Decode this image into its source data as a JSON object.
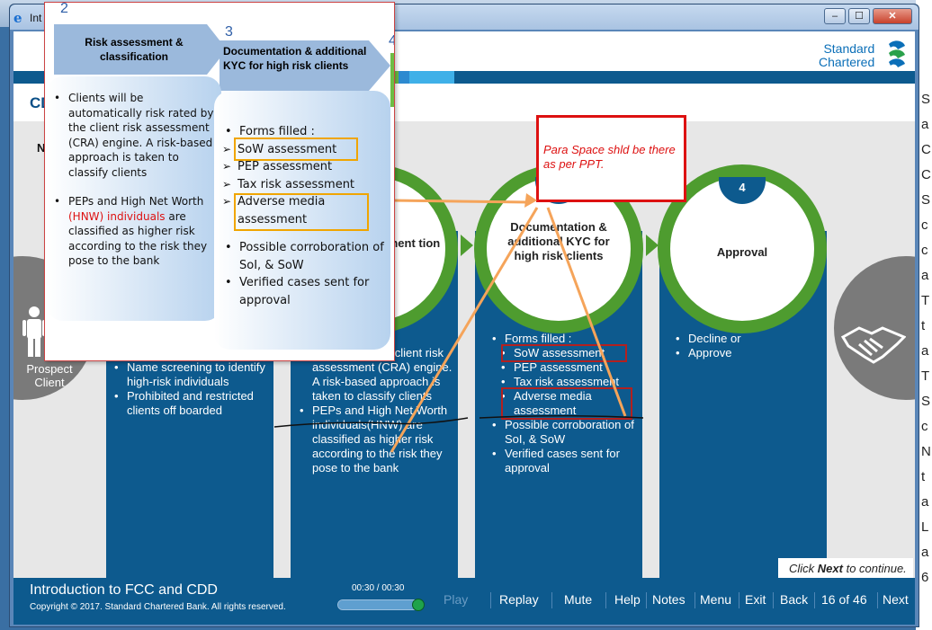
{
  "window": {
    "title": "Int",
    "minimize": "–",
    "maximize": "☐",
    "close": "✕"
  },
  "background_right_text": [
    "S",
    "a",
    "C",
    "C",
    "S",
    "c",
    "c",
    "a",
    "T",
    "t",
    "a",
    "T",
    "S",
    "c",
    "N",
    "t",
    "a",
    "L",
    "a",
    "6"
  ],
  "slide": {
    "logo_line1": "Standard",
    "logo_line2": "Chartered",
    "heading": "CD",
    "sub_heading": "N",
    "prospect_label": "Prospect Client",
    "columns": [
      {
        "items": [
          "Name screening to identify high-risk individuals",
          "Prohibited and restricted clients off boarded"
        ]
      },
      {
        "ring_title": "ment tion",
        "items": [
          "isk rated by the client risk assessment (CRA) engine. A risk-based approach is taken to classify clients",
          "PEPs and High Net Worth individuals(HNW) are classified as higher risk according to the risk they pose to the bank"
        ]
      },
      {
        "number": "3",
        "ring_title": "Documentation & additional KYC for high risk clients",
        "forms_label": "Forms filled :",
        "forms": [
          "SoW assessment",
          "PEP assessment",
          "Tax risk assessment",
          "Adverse media assessment"
        ],
        "items": [
          "Possible corroboration of SoI, & SoW",
          "Verified cases sent for approval"
        ]
      },
      {
        "number": "4",
        "ring_title": "Approval",
        "items": [
          "Decline or",
          "Approve"
        ]
      }
    ],
    "annotation": "Para Space shld be there as per PPT.",
    "click_next_pre": "Click ",
    "click_next_bold": "Next",
    "click_next_post": " to continue.",
    "colors": {
      "navy": "#0d5a8e",
      "green": "#4e9c2f",
      "annotation_red": "#dd1111",
      "arrow_orange": "#f5a45a"
    }
  },
  "player": {
    "course_title": "Introduction to FCC and CDD",
    "copyright": "Copyright © 2017. Standard Chartered Bank. All rights reserved.",
    "time": "00:30 / 00:30",
    "progress": 1.0,
    "buttons": {
      "play": "Play",
      "replay": "Replay",
      "mute": "Mute",
      "help": "Help",
      "notes": "Notes",
      "menu": "Menu",
      "exit": "Exit",
      "back": "Back",
      "next": "Next"
    },
    "page_count": "16 of 46"
  },
  "overlay": {
    "step2_num": "2",
    "step2_title": "Risk assessment & classification",
    "step3_num": "3",
    "step3_title": "Documentation & additional KYC for high risk clients",
    "step4_num": "4",
    "left_bullet1": "Clients will be automatically risk rated by the client risk assessment (CRA) engine. A risk-based approach is taken to classify clients",
    "left_bullet2_pre": "PEPs and High Net Worth ",
    "left_bullet2_red": "(HNW) individuals",
    "left_bullet2_post": " are classified as higher risk according to the risk they pose to the bank",
    "forms_label": "Forms filled :",
    "forms": [
      "SoW assessment",
      "PEP assessment",
      "Tax risk assessment",
      "Adverse media assessment"
    ],
    "right_items": [
      "Possible corroboration of SoI, & SoW",
      "Verified cases sent for approval"
    ]
  }
}
